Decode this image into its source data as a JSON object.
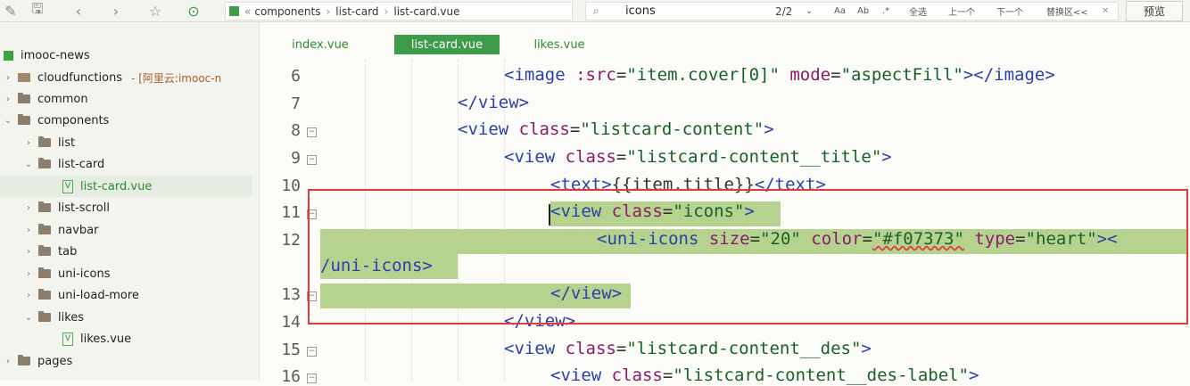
{
  "toolbar": {
    "breadcrumb": [
      "components",
      "list-card",
      "list-card.vue"
    ],
    "breadcrumb_prefix": "«",
    "search_value": "icons",
    "search_count": "2/2",
    "opt_aa": "Aa",
    "opt_word": "Ab",
    "opt_regex": ".*",
    "select_all": "全选",
    "prev": "上一个",
    "next": "下一个",
    "replace": "替换区<<",
    "preview": "预览"
  },
  "sidebar": {
    "root": "imooc-news",
    "items": [
      {
        "label": "cloudfunctions",
        "extra": "- [阿里云:imooc-n"
      },
      {
        "label": "common"
      },
      {
        "label": "components"
      },
      {
        "label": "list"
      },
      {
        "label": "list-card"
      },
      {
        "label": "list-card.vue"
      },
      {
        "label": "list-scroll"
      },
      {
        "label": "navbar"
      },
      {
        "label": "tab"
      },
      {
        "label": "uni-icons"
      },
      {
        "label": "uni-load-more"
      },
      {
        "label": "likes"
      },
      {
        "label": "likes.vue"
      },
      {
        "label": "pages"
      }
    ]
  },
  "tabs": [
    "index.vue",
    "list-card.vue",
    "likes.vue"
  ],
  "editor": {
    "line_numbers": [
      "6",
      "7",
      "8",
      "9",
      "10",
      "11",
      "12",
      "13",
      "14",
      "15",
      "16"
    ],
    "code": {
      "l6": [
        "<image",
        ":src",
        "=",
        "\"item.cover[0]\"",
        "mode",
        "=",
        "\"aspectFill\"",
        "></image>"
      ],
      "l7": "</view>",
      "l8": [
        "<view",
        "class",
        "=",
        "\"listcard-content\"",
        ">"
      ],
      "l9": [
        "<view",
        "class",
        "=",
        "\"listcard-content__title\"",
        ">"
      ],
      "l10": [
        "<text>",
        "{{item.title}}",
        "</text>"
      ],
      "l11": [
        "<view",
        "class",
        "=",
        "\"icons\"",
        ">"
      ],
      "l12a": [
        "<uni-icons",
        "size",
        "=",
        "\"20\"",
        "color",
        "=",
        "\"#f07373\"",
        "type",
        "=",
        "\"heart\"",
        "><"
      ],
      "l12b": "/uni-icons>",
      "l13": "</view>",
      "l14": "</view>",
      "l15": [
        "<view",
        "class",
        "=",
        "\"listcard-content__des\"",
        ">"
      ],
      "l16": [
        "<view",
        "class",
        "=",
        "\"listcard-content__des-label\"",
        ">"
      ]
    }
  }
}
